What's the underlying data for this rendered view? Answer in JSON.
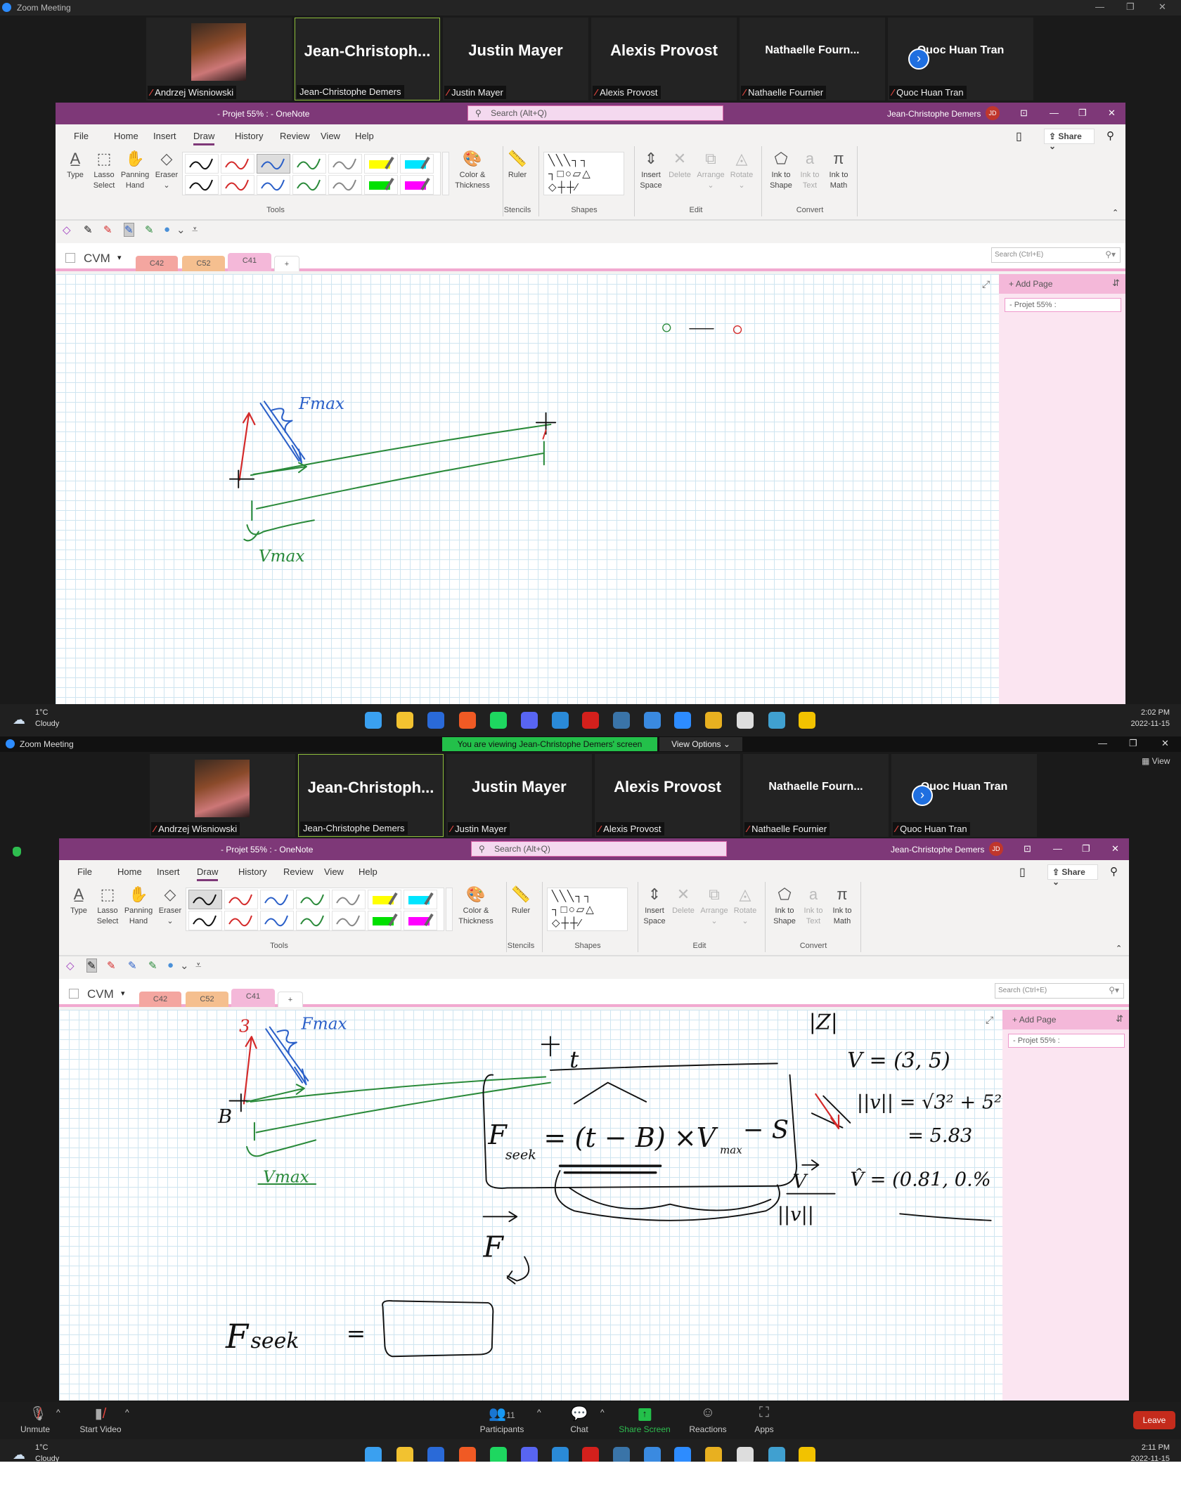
{
  "zoom": {
    "title": "Zoom Meeting",
    "banner": "You are viewing Jean-Christophe Demers' screen",
    "view_options": "View Options",
    "view_label": "View",
    "participants": [
      {
        "big": "",
        "label": "Andrzej Wisniowski",
        "avatar": true,
        "muted": true
      },
      {
        "big": "Jean-Christoph...",
        "label": "Jean-Christophe Demers",
        "active": true,
        "muted": false
      },
      {
        "big": "Justin Mayer",
        "label": "Justin Mayer",
        "muted": true
      },
      {
        "big": "Alexis Provost",
        "label": "Alexis Provost",
        "muted": true
      },
      {
        "big": "Nathaelle  Fourn...",
        "label": "Nathaelle Fournier",
        "muted": true,
        "small": true
      },
      {
        "big": "Quoc Huan Tran",
        "label": "Quoc Huan Tran",
        "muted": true,
        "small": true
      }
    ],
    "toolbar": {
      "unmute": "Unmute",
      "start_video": "Start Video",
      "participants": "Participants",
      "participants_count": "11",
      "chat": "Chat",
      "share": "Share Screen",
      "reactions": "Reactions",
      "apps": "Apps",
      "leave": "Leave"
    }
  },
  "onenote": {
    "title": "- Projet 55% :  -  OneNote",
    "search_placeholder": "Search (Alt+Q)",
    "user": "Jean-Christophe Demers",
    "user_initials": "JD",
    "menu": [
      "File",
      "Home",
      "Insert",
      "Draw",
      "History",
      "Review",
      "View",
      "Help"
    ],
    "active_menu": "Draw",
    "share": "Share",
    "tools": [
      {
        "l1": "Type",
        "l2": "",
        "ic": "A̲"
      },
      {
        "l1": "Lasso",
        "l2": "Select",
        "ic": "⬚"
      },
      {
        "l1": "Panning",
        "l2": "Hand",
        "ic": "✋"
      },
      {
        "l1": "Eraser",
        "l2": "⌄",
        "ic": "◇"
      }
    ],
    "pen_colors": [
      [
        "#111111",
        "#d42a2a",
        "#2a5fc8",
        "#2a8a3a",
        "#888888",
        "#ffff00",
        "#00e5ff"
      ],
      [
        "#111111",
        "#d42a2a",
        "#2a5fc8",
        "#2a8a3a",
        "#888888",
        "#00e000",
        "#ff00ff"
      ]
    ],
    "color_thickness": [
      "Color &",
      "Thickness"
    ],
    "ruler": "Ruler",
    "edit": [
      {
        "l1": "Insert",
        "l2": "Space",
        "ic": "⇕",
        "dis": false
      },
      {
        "l1": "Delete",
        "l2": "",
        "ic": "✕",
        "dis": true
      },
      {
        "l1": "Arrange",
        "l2": "⌄",
        "ic": "⧉",
        "dis": true
      },
      {
        "l1": "Rotate",
        "l2": "⌄",
        "ic": "◬",
        "dis": true
      }
    ],
    "convert": [
      {
        "l1": "Ink to",
        "l2": "Shape",
        "ic": "⬠",
        "dis": false
      },
      {
        "l1": "Ink to",
        "l2": "Text",
        "ic": "a",
        "dis": true
      },
      {
        "l1": "Ink to",
        "l2": "Math",
        "ic": "π",
        "dis": false
      }
    ],
    "groups": [
      "Tools",
      "Stencils",
      "Shapes",
      "Edit",
      "Convert"
    ],
    "notebook": "CVM",
    "sections": [
      {
        "name": "C42",
        "color": "#f4a6a0"
      },
      {
        "name": "C52",
        "color": "#f5bf8f"
      },
      {
        "name": "C41",
        "color": "#f4b8d9"
      }
    ],
    "add_tab": "+",
    "page_search": "Search (Ctrl+E)",
    "add_page": "Add Page",
    "page": "- Projet 55% :"
  },
  "ink_top": {
    "fmax": "Fmax",
    "vmax": "Vmax"
  },
  "ink_bottom": {
    "fmax": "Fmax",
    "vmax": "Vmax",
    "three": "3",
    "b": "B",
    "t": "t",
    "fs": "F",
    "seek": "seek",
    "eq": "= (t − B) ×V",
    "max": "max",
    "minus_s": "− S",
    "v_vec": "V = (3, 5)",
    "norm": "||v|| = √3² + 5²",
    "norm_val": "= 5.83",
    "vhat": "V̂ = (0.81, 0.%",
    "vfrac": "V",
    "vnorm": "||v||",
    "f2": "F",
    "fseek2": "F",
    "seek2": "seek",
    "eq2": "=",
    "z": "|Z|"
  },
  "taskbar_top": {
    "temp": "1°C",
    "weather": "Cloudy",
    "time": "2:02 PM",
    "date": "2022-11-15"
  },
  "taskbar_bottom": {
    "temp": "1°C",
    "weather": "Cloudy",
    "time": "2:11 PM",
    "date": "2022-11-15"
  },
  "taskbar_icons": [
    {
      "n": "windows-start",
      "c": "#3aa0f0"
    },
    {
      "n": "file-explorer",
      "c": "#f2c230"
    },
    {
      "n": "1password",
      "c": "#2a6ad8"
    },
    {
      "n": "brave",
      "c": "#f05a24"
    },
    {
      "n": "spotify",
      "c": "#1ed760"
    },
    {
      "n": "discord",
      "c": "#5865f2"
    },
    {
      "n": "vscode",
      "c": "#2a8ad8"
    },
    {
      "n": "acrobat",
      "c": "#d4201c"
    },
    {
      "n": "python",
      "c": "#3a74a8"
    },
    {
      "n": "photos",
      "c": "#3a8ae0"
    },
    {
      "n": "zoom",
      "c": "#2d8cff"
    },
    {
      "n": "star-app",
      "c": "#e8b020"
    },
    {
      "n": "notepad",
      "c": "#dddddd"
    },
    {
      "n": "globe",
      "c": "#40a0d0"
    },
    {
      "n": "warning",
      "c": "#f2c200"
    }
  ]
}
